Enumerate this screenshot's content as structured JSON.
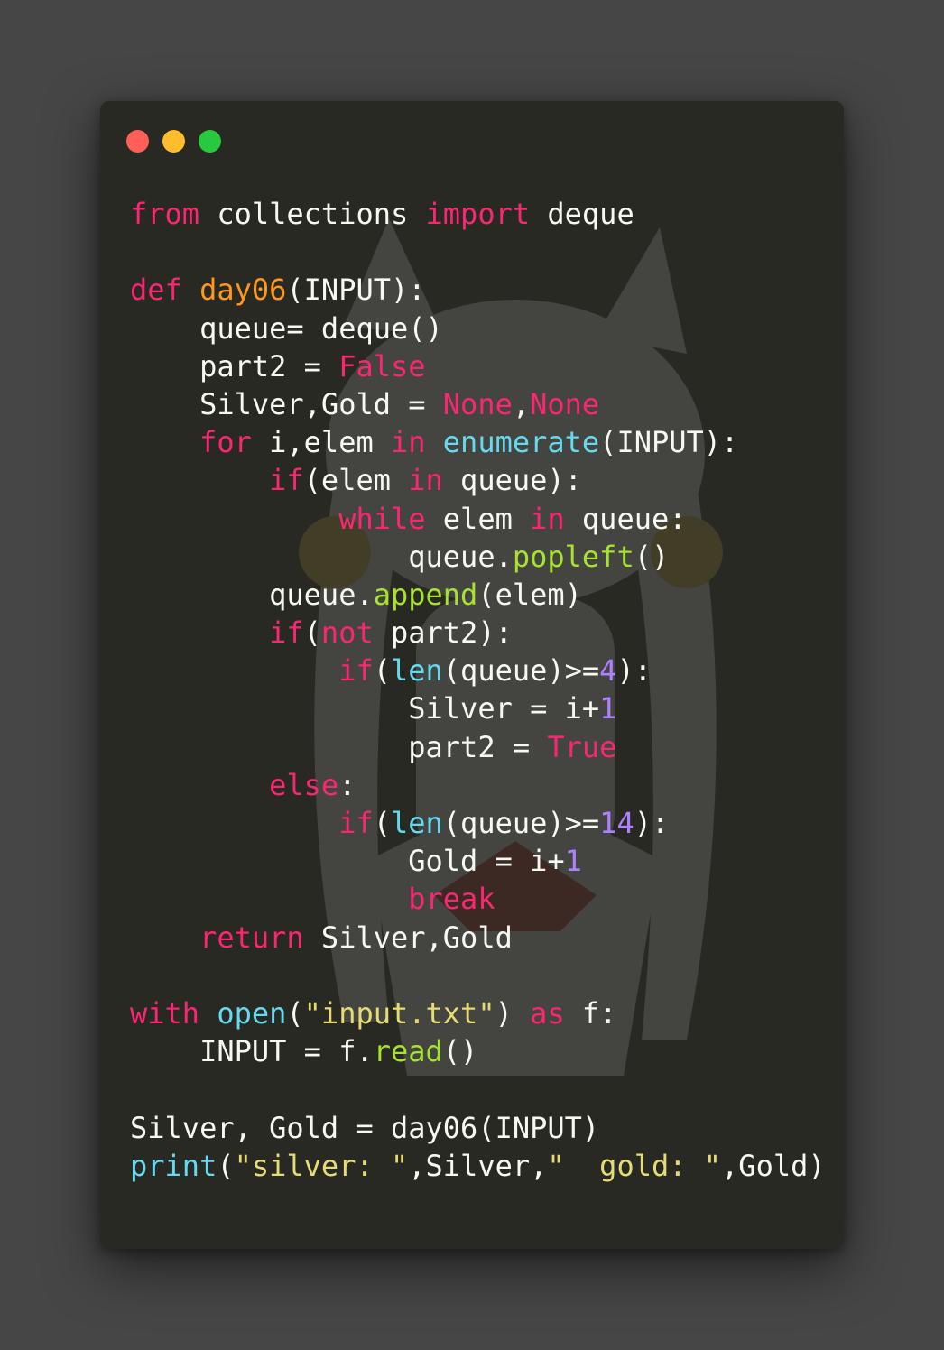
{
  "window": {
    "controls": [
      {
        "name": "close",
        "color": "#ff5f56"
      },
      {
        "name": "minimize",
        "color": "#ffbd2e"
      },
      {
        "name": "maximize",
        "color": "#27c93f"
      }
    ],
    "background": "#282923"
  },
  "theme": {
    "keyword": "#f92672",
    "function": "#fd971f",
    "builtin": "#66d9ef",
    "method": "#a6e22e",
    "number": "#ae81ff",
    "string": "#e6db74",
    "plain": "#f8f8f2"
  },
  "code_lines": [
    [
      {
        "t": "kw",
        "v": "from"
      },
      {
        "t": "plain",
        "v": " collections "
      },
      {
        "t": "kw",
        "v": "import"
      },
      {
        "t": "plain",
        "v": " deque"
      }
    ],
    [],
    [
      {
        "t": "kw",
        "v": "def"
      },
      {
        "t": "plain",
        "v": " "
      },
      {
        "t": "fn",
        "v": "day06"
      },
      {
        "t": "plain",
        "v": "(INPUT):"
      }
    ],
    [
      {
        "t": "plain",
        "v": "    queue= deque()"
      }
    ],
    [
      {
        "t": "plain",
        "v": "    part2 = "
      },
      {
        "t": "kw",
        "v": "False"
      }
    ],
    [
      {
        "t": "plain",
        "v": "    Silver,Gold = "
      },
      {
        "t": "kw",
        "v": "None"
      },
      {
        "t": "plain",
        "v": ","
      },
      {
        "t": "kw",
        "v": "None"
      }
    ],
    [
      {
        "t": "plain",
        "v": "    "
      },
      {
        "t": "kw",
        "v": "for"
      },
      {
        "t": "plain",
        "v": " i,elem "
      },
      {
        "t": "kw",
        "v": "in"
      },
      {
        "t": "plain",
        "v": " "
      },
      {
        "t": "bi",
        "v": "enumerate"
      },
      {
        "t": "plain",
        "v": "(INPUT):"
      }
    ],
    [
      {
        "t": "plain",
        "v": "        "
      },
      {
        "t": "kw",
        "v": "if"
      },
      {
        "t": "plain",
        "v": "(elem "
      },
      {
        "t": "kw",
        "v": "in"
      },
      {
        "t": "plain",
        "v": " queue):"
      }
    ],
    [
      {
        "t": "plain",
        "v": "            "
      },
      {
        "t": "kw",
        "v": "while"
      },
      {
        "t": "plain",
        "v": " elem "
      },
      {
        "t": "kw",
        "v": "in"
      },
      {
        "t": "plain",
        "v": " queue:"
      }
    ],
    [
      {
        "t": "plain",
        "v": "                queue."
      },
      {
        "t": "me",
        "v": "popleft"
      },
      {
        "t": "plain",
        "v": "()"
      }
    ],
    [
      {
        "t": "plain",
        "v": "        queue."
      },
      {
        "t": "me",
        "v": "append"
      },
      {
        "t": "plain",
        "v": "(elem)"
      }
    ],
    [
      {
        "t": "plain",
        "v": "        "
      },
      {
        "t": "kw",
        "v": "if"
      },
      {
        "t": "plain",
        "v": "("
      },
      {
        "t": "kw",
        "v": "not"
      },
      {
        "t": "plain",
        "v": " part2):"
      }
    ],
    [
      {
        "t": "plain",
        "v": "            "
      },
      {
        "t": "kw",
        "v": "if"
      },
      {
        "t": "plain",
        "v": "("
      },
      {
        "t": "bi",
        "v": "len"
      },
      {
        "t": "plain",
        "v": "(queue)>="
      },
      {
        "t": "num",
        "v": "4"
      },
      {
        "t": "plain",
        "v": "):"
      }
    ],
    [
      {
        "t": "plain",
        "v": "                Silver = i+"
      },
      {
        "t": "num",
        "v": "1"
      }
    ],
    [
      {
        "t": "plain",
        "v": "                part2 = "
      },
      {
        "t": "kw",
        "v": "True"
      }
    ],
    [
      {
        "t": "plain",
        "v": "        "
      },
      {
        "t": "kw",
        "v": "else"
      },
      {
        "t": "plain",
        "v": ":"
      }
    ],
    [
      {
        "t": "plain",
        "v": "            "
      },
      {
        "t": "kw",
        "v": "if"
      },
      {
        "t": "plain",
        "v": "("
      },
      {
        "t": "bi",
        "v": "len"
      },
      {
        "t": "plain",
        "v": "(queue)>="
      },
      {
        "t": "num",
        "v": "14"
      },
      {
        "t": "plain",
        "v": "):"
      }
    ],
    [
      {
        "t": "plain",
        "v": "                Gold = i+"
      },
      {
        "t": "num",
        "v": "1"
      }
    ],
    [
      {
        "t": "plain",
        "v": "                "
      },
      {
        "t": "kw",
        "v": "break"
      }
    ],
    [
      {
        "t": "plain",
        "v": "    "
      },
      {
        "t": "kw",
        "v": "return"
      },
      {
        "t": "plain",
        "v": " Silver,Gold"
      }
    ],
    [],
    [
      {
        "t": "kw",
        "v": "with"
      },
      {
        "t": "plain",
        "v": " "
      },
      {
        "t": "bi",
        "v": "open"
      },
      {
        "t": "plain",
        "v": "("
      },
      {
        "t": "str",
        "v": "\"input.txt\""
      },
      {
        "t": "plain",
        "v": ") "
      },
      {
        "t": "kw",
        "v": "as"
      },
      {
        "t": "plain",
        "v": " f:"
      }
    ],
    [
      {
        "t": "plain",
        "v": "    INPUT = f."
      },
      {
        "t": "me",
        "v": "read"
      },
      {
        "t": "plain",
        "v": "()"
      }
    ],
    [],
    [
      {
        "t": "plain",
        "v": "Silver, Gold = day06(INPUT)"
      }
    ],
    [
      {
        "t": "bi",
        "v": "print"
      },
      {
        "t": "plain",
        "v": "("
      },
      {
        "t": "str",
        "v": "\"silver: \""
      },
      {
        "t": "plain",
        "v": ",Silver,"
      },
      {
        "t": "str",
        "v": "\"  gold: \""
      },
      {
        "t": "plain",
        "v": ",Gold)"
      }
    ]
  ]
}
